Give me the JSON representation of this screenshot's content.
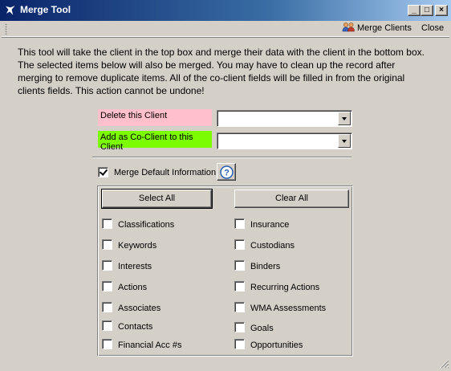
{
  "window": {
    "title": "Merge Tool",
    "minimize": "_",
    "maximize": "□",
    "close": "×"
  },
  "toolbar": {
    "merge_clients_label": "Merge Clients",
    "close_label": "Close"
  },
  "description": "This tool will take the client in the top box and merge their data with the client in the bottom box.  The selected items below will also be merged.  You may have to clean up the record after merging to remove duplicate items.  All of the co-client fields will be filled in from the original clients fields.  This action cannot be undone!",
  "delete_client": {
    "label": "Delete this Client",
    "value": "",
    "color": "#ffc0cb"
  },
  "add_coclient": {
    "label": "Add as Co-Client to this Client",
    "value": "",
    "color": "#7cfc00"
  },
  "merge_default": {
    "label": "Merge Default Information",
    "checked": true
  },
  "buttons": {
    "select_all": "Select All",
    "clear_all": "Clear All"
  },
  "options_left": [
    {
      "label": "Classifications",
      "checked": false
    },
    {
      "label": "Keywords",
      "checked": false
    },
    {
      "label": "Interests",
      "checked": false
    },
    {
      "label": "Actions",
      "checked": false
    },
    {
      "label": "Associates",
      "checked": false
    },
    {
      "label": "Contacts",
      "checked": false
    },
    {
      "label": "Financial Acc #s",
      "checked": false
    }
  ],
  "options_right": [
    {
      "label": "Insurance",
      "checked": false
    },
    {
      "label": "Custodians",
      "checked": false
    },
    {
      "label": "Binders",
      "checked": false
    },
    {
      "label": "Recurring Actions",
      "checked": false
    },
    {
      "label": "WMA Assessments",
      "checked": false
    },
    {
      "label": "Goals",
      "checked": false
    },
    {
      "label": "Opportunities",
      "checked": false
    }
  ]
}
